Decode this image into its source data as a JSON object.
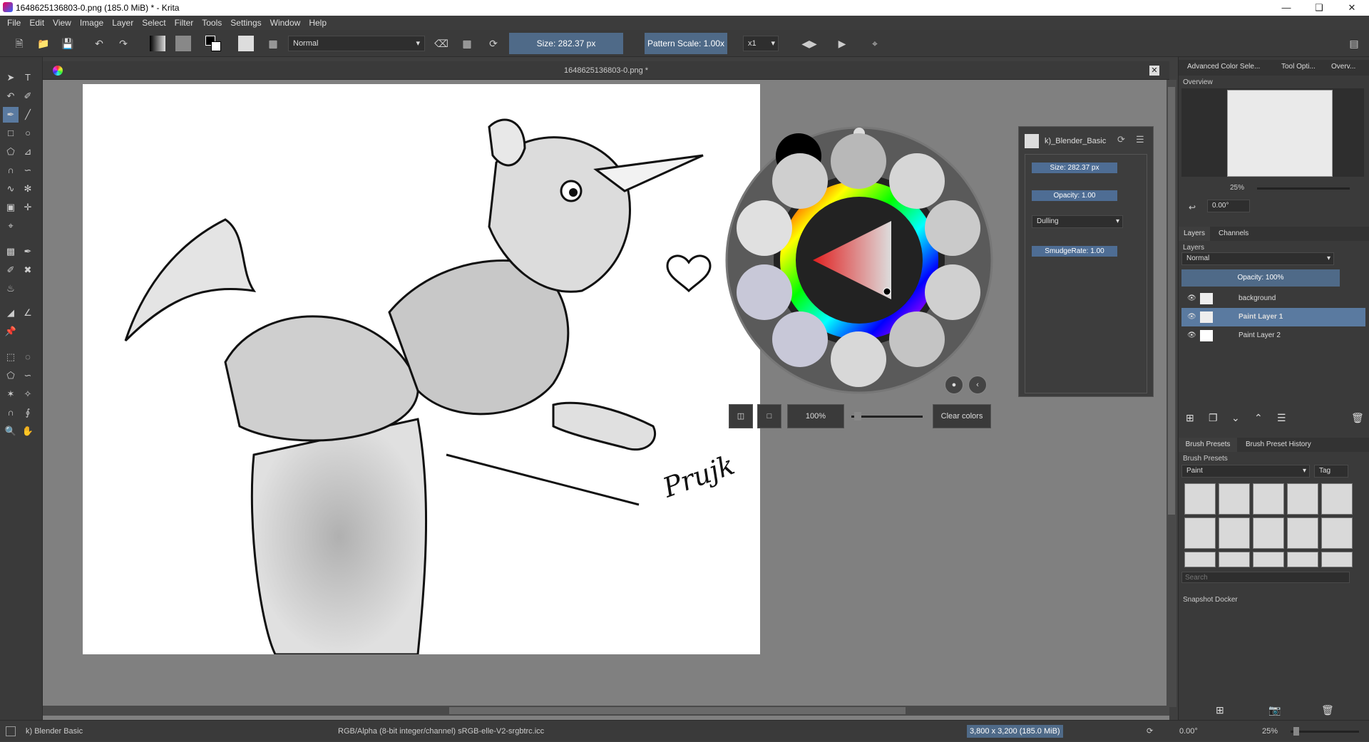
{
  "window": {
    "title": "1648625136803-0.png (185.0 MiB)  * - Krita"
  },
  "menu": [
    "File",
    "Edit",
    "View",
    "Image",
    "Layer",
    "Select",
    "Filter",
    "Tools",
    "Settings",
    "Window",
    "Help"
  ],
  "toolbar": {
    "blend_mode": "Normal",
    "size": "Size: 282.37 px",
    "pattern_scale": "Pattern Scale: 1.00x",
    "multiplier": "x1"
  },
  "document": {
    "tab_title": "1648625136803-0.png *",
    "signature": "Prujk"
  },
  "popup": {
    "preset_name": "k)_Blender_Basic",
    "size": "Size: 282.37 px",
    "opacity": "Opacity: 1.00",
    "mode": "Dulling",
    "smudge_rate": "SmudgeRate: 1.00",
    "zoom": "100%",
    "clear_colors": "Clear colors"
  },
  "dock": {
    "tabs": [
      "Advanced Color Sele...",
      "Tool Opti...",
      "Overv..."
    ],
    "overview_title": "Overview",
    "overview_zoom": "25%",
    "overview_rotation": "0.00°",
    "layer_tabs": [
      "Layers",
      "Channels"
    ],
    "layers_title": "Layers",
    "layers_blend": "Normal",
    "layers_opacity": "Opacity:  100%",
    "layers": [
      {
        "name": "background",
        "selected": false
      },
      {
        "name": "Paint Layer 1",
        "selected": true
      },
      {
        "name": "Paint Layer 2",
        "selected": false
      }
    ],
    "preset_tabs": [
      "Brush Presets",
      "Brush Preset History"
    ],
    "presets_title": "Brush Presets",
    "preset_tag": "Paint",
    "tag_label": "Tag",
    "search_placeholder": "Search",
    "snapshot_title": "Snapshot Docker"
  },
  "status": {
    "brush": "k) Blender Basic",
    "colorspace": "RGB/Alpha (8-bit integer/channel)  sRGB-elle-V2-srgbtrc.icc",
    "dimensions": "3,800 x 3,200 (185.0 MiB)",
    "rotation": "0.00°",
    "zoom": "25%"
  },
  "colors": {
    "accent": "#4f6a88",
    "selection": "#5a7aa0",
    "panel": "#3a3a3a",
    "canvas_bg": "#808080"
  }
}
